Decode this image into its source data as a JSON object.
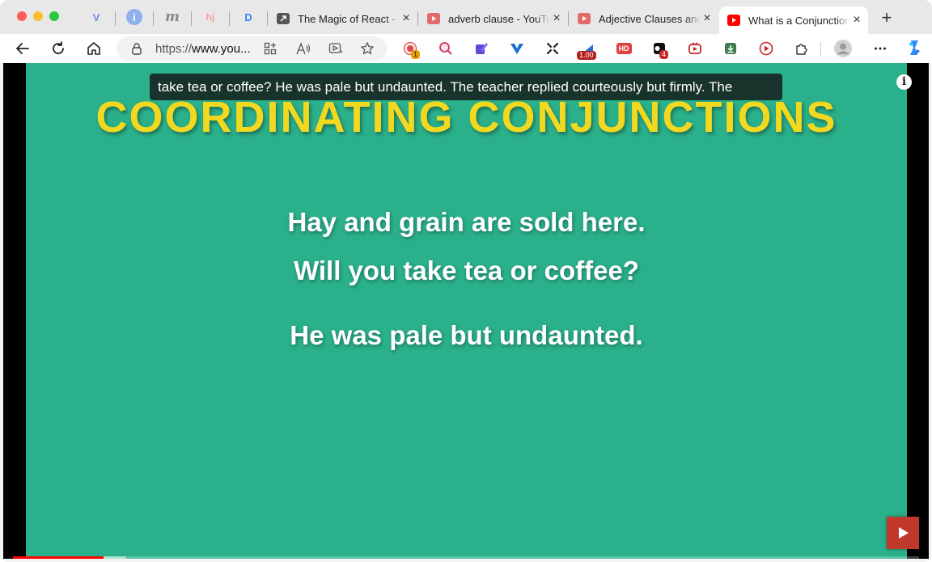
{
  "browser": {
    "pinned_tabs": [
      {
        "icon": "vee-icon",
        "glyph": "V",
        "color": "#6d8fd8"
      },
      {
        "icon": "info-icon",
        "glyph": "i",
        "color": "#6a8fe0"
      },
      {
        "icon": "m-logo-icon",
        "glyph": "m",
        "color": "#888888"
      },
      {
        "icon": "hj-logo-icon",
        "glyph": "hj",
        "color": "#f2a5a5"
      },
      {
        "icon": "d-logo-icon",
        "glyph": "D",
        "color": "#3b82f6"
      }
    ],
    "tabs": [
      {
        "title": "The Magic of React - ",
        "favicon": "arrow-square-icon",
        "active": false
      },
      {
        "title": "adverb clause - YouTube",
        "favicon": "youtube-icon",
        "active": false
      },
      {
        "title": "Adjective Clauses and",
        "favicon": "youtube-icon",
        "active": false
      },
      {
        "title": "What is a Conjunction",
        "favicon": "youtube-icon",
        "active": true
      }
    ],
    "url_prefix": "https://",
    "url_host": "www.you...",
    "extensions": {
      "badge_1": "1",
      "speed_badge": "1.00",
      "hd_badge": "HD",
      "badge_4": "4"
    }
  },
  "video": {
    "caption": "take tea or coffee? He was pale but undaunted.  The teacher replied courteously but firmly. The",
    "heading": "COORDINATING CONJUNCTIONS",
    "lines": [
      "Hay and grain are sold here.",
      "Will you take tea or coffee?",
      "He was pale but undaunted."
    ],
    "info_glyph": "i",
    "progress": {
      "played_fraction": 0.1,
      "buffered_fraction": 0.125
    },
    "colors": {
      "background": "#2ab08a",
      "heading": "#f2d91f",
      "text": "#ffffff"
    }
  }
}
